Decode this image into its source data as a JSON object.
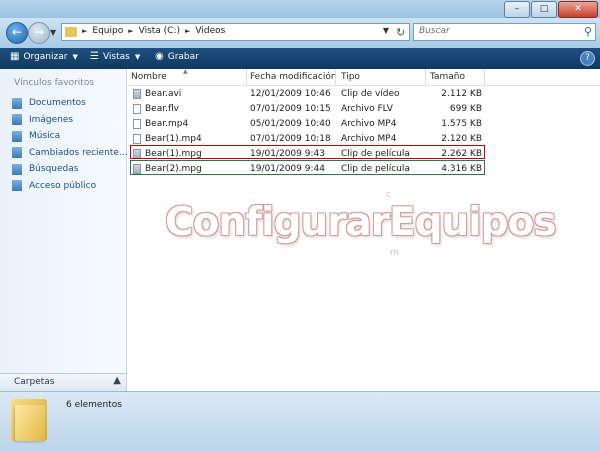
{
  "window": {
    "minimize_icon": "minimize-icon",
    "maximize_icon": "maximize-icon",
    "close_icon": "close-icon"
  },
  "address": {
    "breadcrumbs": [
      "Equipo",
      "Vista (C:)",
      "Videos"
    ],
    "search_placeholder": "Buscar"
  },
  "toolbar": {
    "organize": "Organizar",
    "views": "Vistas",
    "burn": "Grabar"
  },
  "nav": {
    "header": "Vínculos favoritos",
    "items": [
      {
        "label": "Documentos",
        "icon": "documents-icon"
      },
      {
        "label": "Imágenes",
        "icon": "pictures-icon"
      },
      {
        "label": "Música",
        "icon": "music-icon"
      },
      {
        "label": "Cambiados reciente...",
        "icon": "recent-icon"
      },
      {
        "label": "Búsquedas",
        "icon": "searches-icon"
      },
      {
        "label": "Acceso público",
        "icon": "public-icon"
      }
    ],
    "folders_label": "Carpetas"
  },
  "columns": {
    "name": "Nombre",
    "date": "Fecha modificación",
    "type": "Tipo",
    "size": "Tamaño"
  },
  "files": [
    {
      "name": "Bear.avi",
      "date": "12/01/2009 10:46",
      "type": "Clip de vídeo",
      "size": "2.112 KB"
    },
    {
      "name": "Bear.flv",
      "date": "07/01/2009 10:15",
      "type": "Archivo FLV",
      "size": "699 KB"
    },
    {
      "name": "Bear.mp4",
      "date": "05/01/2009 10:40",
      "type": "Archivo MP4",
      "size": "1.575 KB"
    },
    {
      "name": "Bear(1).mp4",
      "date": "07/01/2009 10:18",
      "type": "Archivo MP4",
      "size": "2.120 KB"
    },
    {
      "name": "Bear(1).mpg",
      "date": "19/01/2009 9:43",
      "type": "Clip de película",
      "size": "2.262 KB"
    },
    {
      "name": "Bear(2).mpg",
      "date": "19/01/2009 9:44",
      "type": "Clip de película",
      "size": "4.316 KB"
    }
  ],
  "highlight_colors": {
    "red": "#c00000",
    "green": "#2a7a40"
  },
  "watermark": {
    "text": "ConfigurarEquipos",
    "top_letter": "c",
    "bottom_letter": "m"
  },
  "status": {
    "count": "6 elementos"
  }
}
